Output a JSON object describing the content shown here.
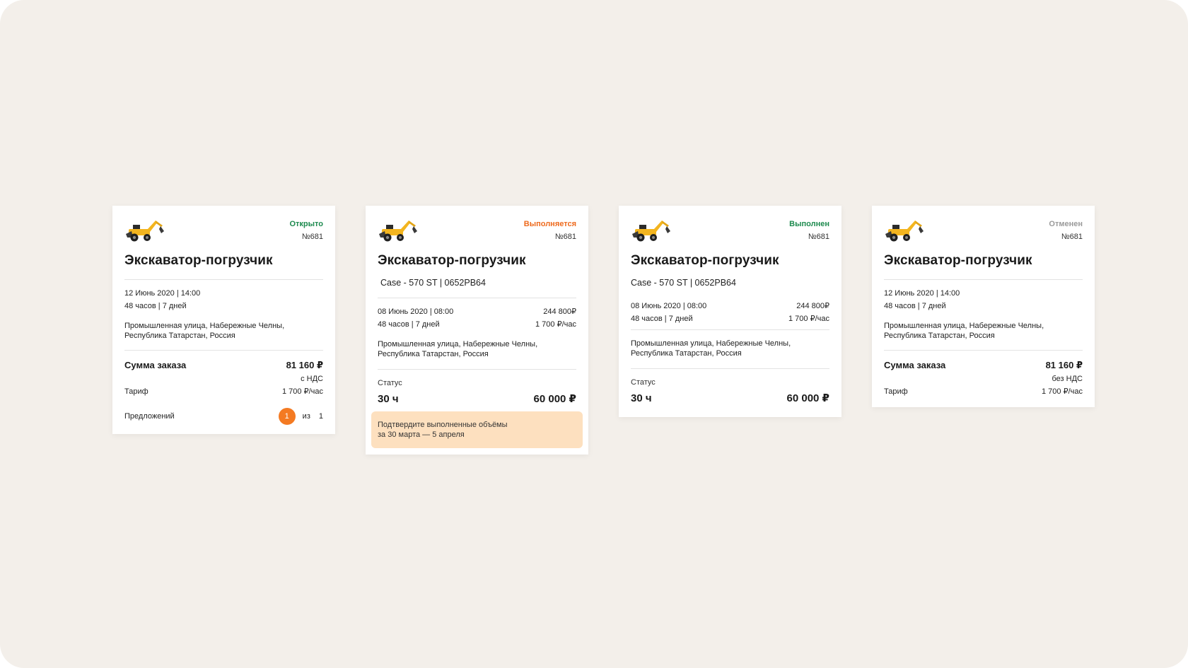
{
  "colors": {
    "background": "#f3efea",
    "status_open": "#1d8a4e",
    "status_in_progress": "#ee6a1d",
    "status_done": "#1d8a4e",
    "status_cancelled": "#9a9a9a",
    "badge": "#f47a22",
    "notice_bg": "#fde0bf"
  },
  "cards": [
    {
      "icon": "backhoe-loader-icon",
      "status": "Открыто",
      "order_no": "№681",
      "title": "Экскаватор-погрузчик",
      "date": "12 Июнь 2020 | 14:00",
      "duration": "48 часов | 7 дней",
      "address_line1": "Промышленная улица, Набережные Челны,",
      "address_line2": "Республика Татарстан, Россия",
      "sum_label": "Сумма заказа",
      "sum_value": "81 160 ₽",
      "vat": "с НДС",
      "tariff_label": "Тариф",
      "tariff_value": "1 700 ₽/час",
      "offers_label": "Предложений",
      "offers_count": "1",
      "offers_of": "из",
      "offers_total": "1"
    },
    {
      "icon": "backhoe-loader-icon",
      "status": "Выполняется",
      "order_no": "№681",
      "title": "Экскаватор-погрузчик",
      "vehicle": "Case - 570 ST | 0652PB64",
      "date": "08 Июнь 2020 | 08:00",
      "duration": "48 часов | 7 дней",
      "price": "244 800₽",
      "rate": "1 700 ₽/час",
      "address_line1": "Промышленная улица, Набережные Челны,",
      "address_line2": "Республика Татарстан, Россия",
      "status_label": "Статус",
      "hours": "30 ч",
      "amount": "60 000 ₽",
      "notice_line1": "Подтвердите выполненные объёмы",
      "notice_line2": "за 30 марта — 5 апреля"
    },
    {
      "icon": "backhoe-loader-icon",
      "status": "Выполнен",
      "order_no": "№681",
      "title": "Экскаватор-погрузчик",
      "vehicle": "Case - 570 ST | 0652PB64",
      "date": "08 Июнь 2020 | 08:00",
      "duration": "48 часов | 7 дней",
      "price": "244 800₽",
      "rate": "1 700 ₽/час",
      "address_line1": "Промышленная улица, Набережные Челны,",
      "address_line2": "Республика Татарстан, Россия",
      "status_label": "Статус",
      "hours": "30 ч",
      "amount": "60 000 ₽"
    },
    {
      "icon": "backhoe-loader-icon",
      "status": "Отменен",
      "order_no": "№681",
      "title": "Экскаватор-погрузчик",
      "date": "12 Июнь 2020 | 14:00",
      "duration": "48 часов | 7 дней",
      "address_line1": "Промышленная улица, Набережные Челны,",
      "address_line2": "Республика Татарстан, Россия",
      "sum_label": "Сумма заказа",
      "sum_value": "81 160 ₽",
      "vat": "без НДС",
      "tariff_label": "Тариф",
      "tariff_value": "1 700 ₽/час"
    }
  ]
}
